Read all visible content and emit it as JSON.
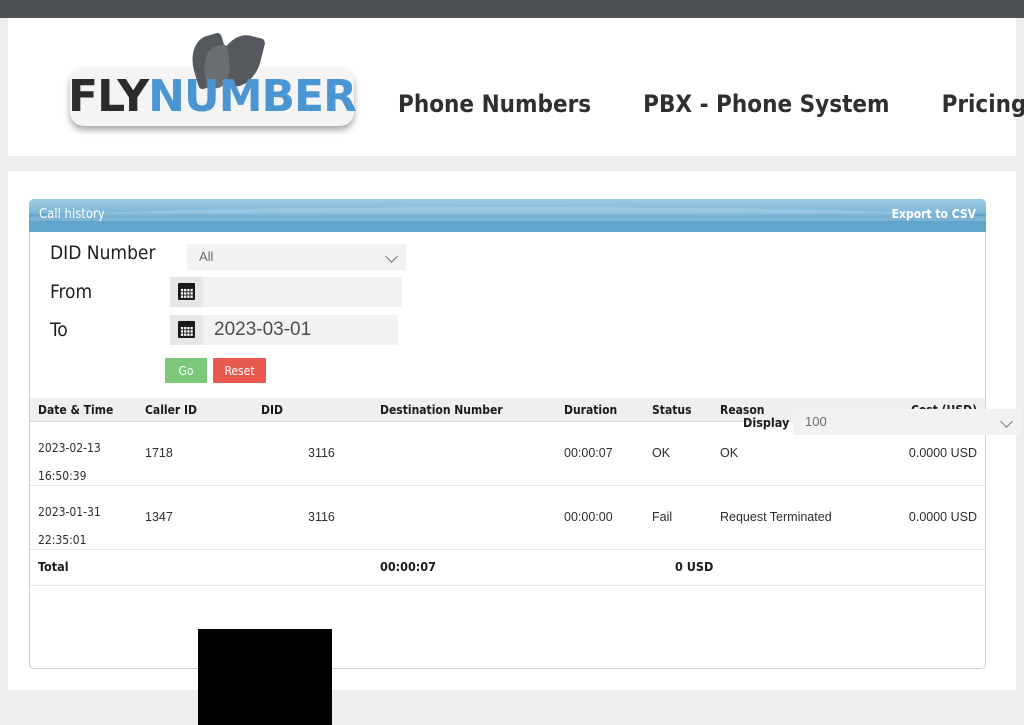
{
  "browser": {
    "topbar_color": "#4c5055"
  },
  "site": {
    "logo": {
      "part1": "FLY",
      "part2": "NUMBER",
      "icon": "wings-icon"
    },
    "nav": [
      {
        "label": "Phone Numbers"
      },
      {
        "label": "PBX - Phone System"
      },
      {
        "label": "Pricing"
      }
    ]
  },
  "panel": {
    "title": "Call history",
    "export_label": "Export to CSV"
  },
  "filters": {
    "did": {
      "label": "DID Number",
      "value": "All",
      "options": [
        "All"
      ],
      "icon": "chevron-down-icon"
    },
    "from": {
      "label": "From",
      "value": "",
      "placeholder": "",
      "icon": "calendar-icon"
    },
    "to": {
      "label": "To",
      "value": "2023-03-01",
      "icon": "calendar-icon"
    },
    "go_label": "Go",
    "reset_label": "Reset",
    "go_color": "#7bc87b",
    "reset_color": "#e9584f"
  },
  "table": {
    "columns": [
      "Date & Time",
      "Caller ID",
      "DID",
      "Destination Number",
      "Duration",
      "Status",
      "Reason",
      "Cost (USD)"
    ],
    "rows": [
      {
        "date": "2023-02-13",
        "time": "16:50:39",
        "caller_id": "1718",
        "did": "3116",
        "destination": "",
        "duration": "00:00:07",
        "status": "OK",
        "reason": "OK",
        "cost": "0.0000 USD"
      },
      {
        "date": "2023-01-31",
        "time": "22:35:01",
        "caller_id": "1347",
        "did": "3116",
        "destination": "",
        "duration": "00:00:00",
        "status": "Fail",
        "reason": "Request Terminated",
        "cost": "0.0000 USD"
      }
    ],
    "total": {
      "label": "Total",
      "duration": "00:00:07",
      "cost": "0 USD"
    }
  },
  "footer": {
    "display_label": "Display #",
    "display_value": "100",
    "display_options": [
      "100"
    ],
    "icon": "chevron-down-icon"
  }
}
